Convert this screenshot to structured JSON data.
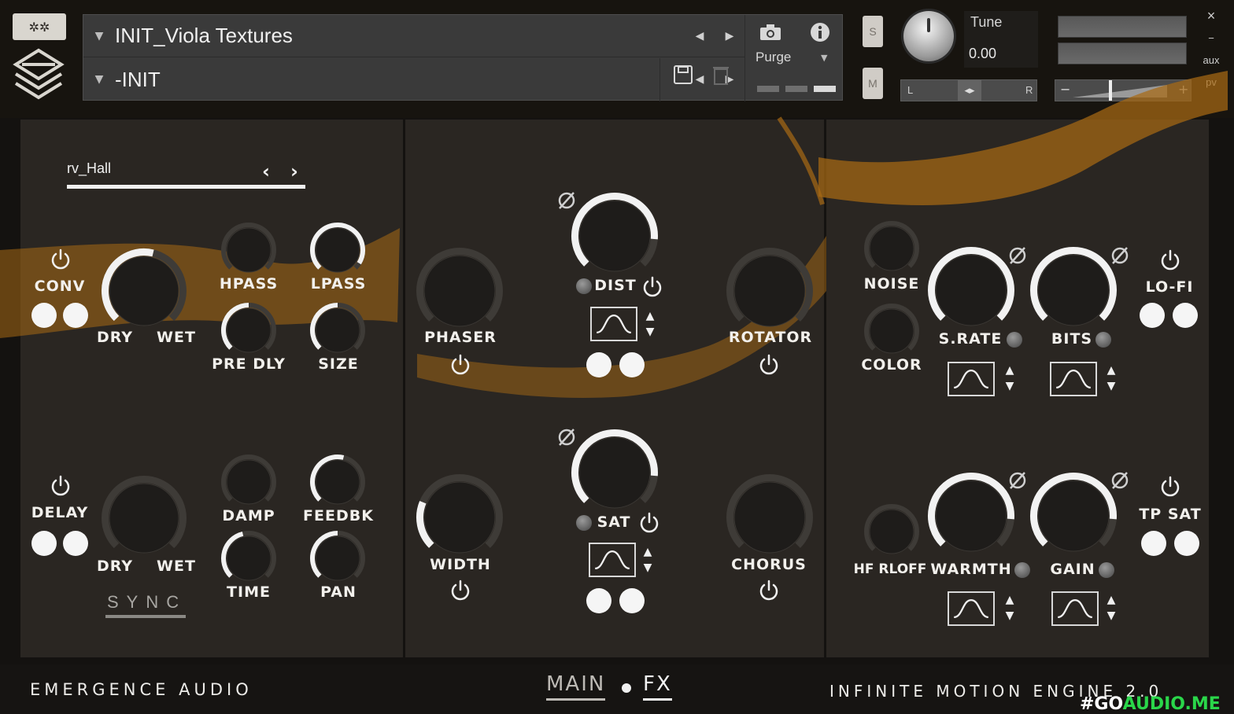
{
  "header": {
    "preset_name": "INIT_Viola Textures",
    "snapshot_name": "-INIT",
    "purge_label": "Purge",
    "solo_label": "S",
    "mute_label": "M",
    "tune_label": "Tune",
    "tune_value": "0.00",
    "pan_left": "L",
    "pan_right": "R",
    "gain_minus": "−",
    "gain_plus": "+",
    "aux_label": "aux",
    "pv_label": "pv",
    "close_label": "×",
    "minimize_label": "−"
  },
  "icons": [
    "logo-badge-icon",
    "logo-mark-icon",
    "caret-down-icon",
    "arrow-left-icon",
    "arrow-right-icon",
    "camera-icon",
    "info-icon",
    "save-icon",
    "trash-icon",
    "power-icon",
    "phase-invert-icon",
    "lfo-sine-icon",
    "up-down-arrows-icon"
  ],
  "colors": {
    "gold_accent": "#a86a14",
    "panel_bg": "#2a2622",
    "header_bg": "#17140f",
    "knob_arc": "#f2f2f2"
  },
  "reverb": {
    "impulse_name": "rv_Hall",
    "enable_label": "CONV",
    "dry_label": "DRY",
    "wet_label": "WET",
    "hpass_label": "HPASS",
    "lpass_label": "LPASS",
    "predly_label": "PRE DLY",
    "size_label": "SIZE",
    "mix": 0.55,
    "hpass": 0.0,
    "lpass": 0.95,
    "predly": 0.5,
    "size": 0.5
  },
  "delay": {
    "enable_label": "DELAY",
    "dry_label": "DRY",
    "wet_label": "WET",
    "damp_label": "DAMP",
    "feedbk_label": "FEEDBK",
    "time_label": "TIME",
    "pan_label": "PAN",
    "sync_label": "SYNC",
    "mix": 0.0,
    "damp": 0.0,
    "feedbk": 0.55,
    "time": 0.45,
    "pan": 0.5
  },
  "modulation": {
    "phaser_label": "PHASER",
    "dist_label": "DIST",
    "rotator_label": "ROTATOR",
    "width_label": "WIDTH",
    "sat_label": "SAT",
    "chorus_label": "CHORUS",
    "phaser": 0.0,
    "dist": 0.85,
    "rotator": 0.0,
    "width": 0.25,
    "sat": 0.85,
    "chorus": 0.0
  },
  "lofi": {
    "noise_label": "NOISE",
    "color_label": "COLOR",
    "srate_label": "S.RATE",
    "bits_label": "BITS",
    "lofi_label": "LO-FI",
    "noise": 0.0,
    "color": 0.0,
    "srate": 1.0,
    "bits": 1.0
  },
  "tape": {
    "hfrolloff_label": "HF RLOFF",
    "warmth_label": "WARMTH",
    "gain_label": "GAIN",
    "tpsat_label": "TP SAT",
    "hfrolloff": 0.0,
    "warmth": 0.85,
    "gain": 0.85
  },
  "footer": {
    "brand": "EMERGENCE AUDIO",
    "tab_main": "MAIN",
    "tab_fx": "FX",
    "engine_name": "INFINITE MOTION ENGINE 2.0",
    "watermark_prefix": "#GO",
    "watermark_suffix": "AUDIO.ME"
  }
}
